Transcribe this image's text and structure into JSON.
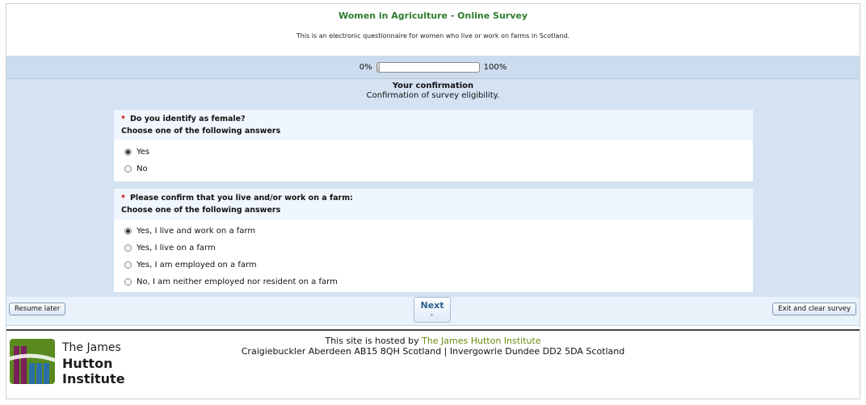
{
  "header": {
    "title": "Women in Agriculture - Online Survey",
    "description": "This is an electronic questionnaire for women who live or work on farms in Scotland."
  },
  "progress": {
    "min_label": "0%",
    "max_label": "100%",
    "value_percent": 0
  },
  "group": {
    "title": "Your confirmation",
    "description": "Confirmation of survey eligibility."
  },
  "questions": [
    {
      "required_mark": "*",
      "text": "Do you identify as female?",
      "help": "Choose one of the following answers",
      "options": [
        {
          "label": "Yes",
          "selected": true
        },
        {
          "label": "No",
          "selected": false
        }
      ]
    },
    {
      "required_mark": "*",
      "text": "Please confirm that you live and/or work on a farm:",
      "help": "Choose one of the following answers",
      "options": [
        {
          "label": "Yes, I live and work on a farm",
          "selected": true
        },
        {
          "label": "Yes, I live on a farm",
          "selected": false
        },
        {
          "label": "Yes, I am employed on a farm",
          "selected": false
        },
        {
          "label": "No, I am neither employed nor resident on a farm",
          "selected": false
        }
      ]
    }
  ],
  "nav": {
    "resume_label": "Resume later",
    "next_label": "Next",
    "next_arrow": "▸",
    "exit_label": "Exit and clear survey"
  },
  "footer": {
    "hosted_prefix": "This site is hosted by ",
    "host_name": "The James Hutton Institute",
    "address": "Craigiebuckler Aberdeen AB15 8QH Scotland | Invergowrie Dundee DD2 5DA Scotland",
    "logo": {
      "line1": "The James",
      "line2": "Hutton",
      "line3": "Institute",
      "colors": [
        "#5a8a1f",
        "#7a1f5c",
        "#2b6fa6"
      ]
    }
  }
}
